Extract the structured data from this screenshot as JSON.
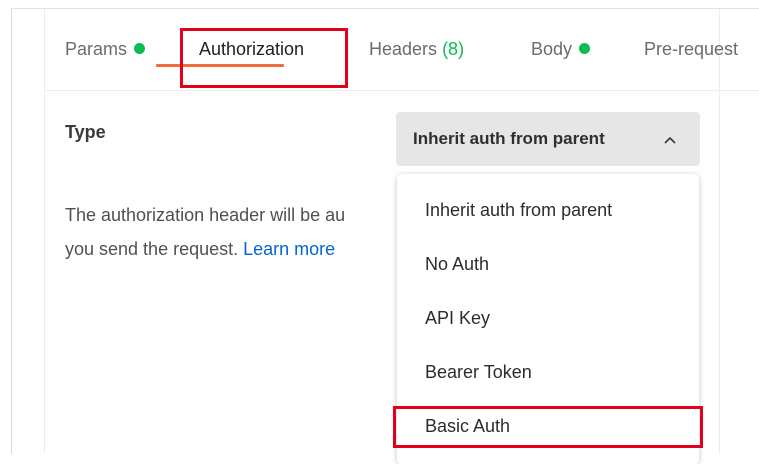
{
  "tabs": {
    "params": "Params",
    "authorization": "Authorization",
    "headers": "Headers",
    "headers_count": "(8)",
    "body": "Body",
    "prerequest": "Pre-request"
  },
  "auth": {
    "type_label": "Type",
    "selected": "Inherit auth from parent",
    "description_line1": "The authorization header will be au",
    "description_line2": "you send the request.",
    "learn_more": "Learn more"
  },
  "dropdown": {
    "options": [
      "Inherit auth from parent",
      "No Auth",
      "API Key",
      "Bearer Token",
      "Basic Auth"
    ]
  },
  "colors": {
    "active_tab_underline": "#f26b3a",
    "status_dot": "#0cbb52",
    "link": "#0265d2",
    "annotation_box": "#e3001b"
  }
}
